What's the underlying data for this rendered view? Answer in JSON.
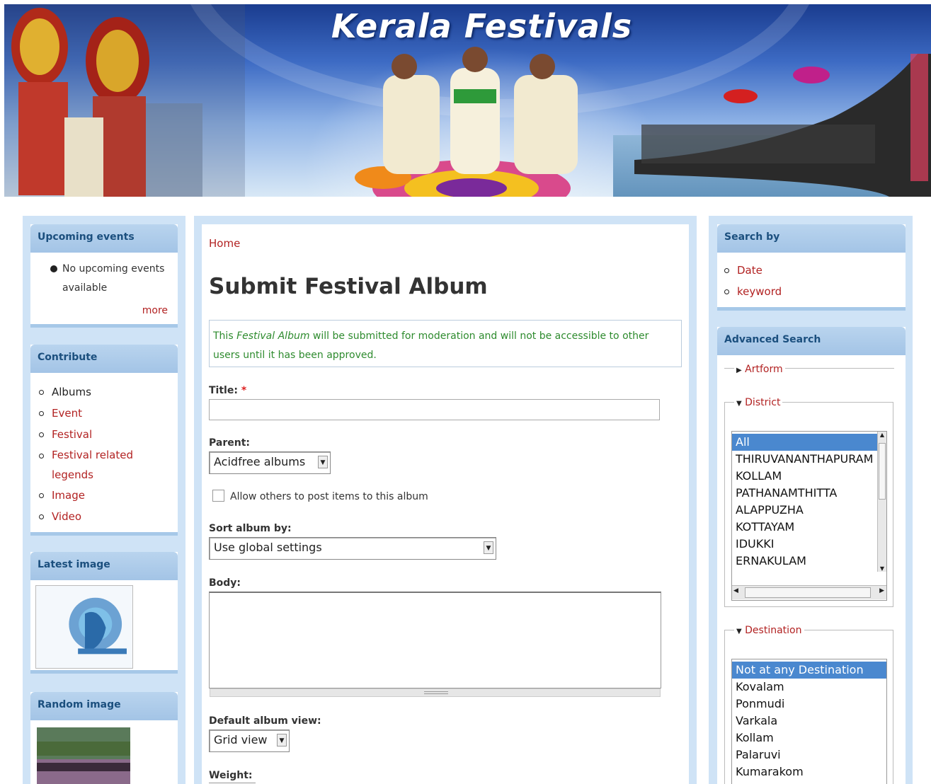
{
  "banner": {
    "title": "Kerala Festivals"
  },
  "left": {
    "upcoming": {
      "title": "Upcoming events",
      "empty_text": "No upcoming events available",
      "more": "more"
    },
    "contribute": {
      "title": "Contribute",
      "items": [
        "Albums",
        "Event",
        "Festival",
        "Festival related legends",
        "Image",
        "Video"
      ]
    },
    "latest_image": {
      "title": "Latest image"
    },
    "random_image": {
      "title": "Random image"
    }
  },
  "main": {
    "breadcrumb": "Home",
    "page_title": "Submit Festival Album",
    "message": {
      "prefix": "This ",
      "em": "Festival Album",
      "suffix": " will be submitted for moderation and will not be accessible to other users until it has been approved."
    },
    "title_label": "Title:",
    "required_mark": "*",
    "title_value": "",
    "parent_label": "Parent:",
    "parent_value": "Acidfree albums",
    "allow_label": "Allow others to post items to this album",
    "sort_label": "Sort album by:",
    "sort_value": "Use global settings",
    "body_label": "Body:",
    "default_view_label": "Default album view:",
    "default_view_value": "Grid view",
    "weight_label": "Weight:"
  },
  "right": {
    "search_by": {
      "title": "Search by",
      "items": [
        "Date",
        "keyword"
      ]
    },
    "advanced": {
      "title": "Advanced Search",
      "artform_legend": "Artform",
      "district_legend": "District",
      "districts": [
        "All",
        "THIRUVANANTHAPURAM",
        "KOLLAM",
        "PATHANAMTHITTA",
        "ALAPPUZHA",
        "KOTTAYAM",
        "IDUKKI",
        "ERNAKULAM"
      ],
      "district_selected": "All",
      "destination_legend": "Destination",
      "destinations": [
        "Not at any Destination",
        "Kovalam",
        "Ponmudi",
        "Varkala",
        "Kollam",
        "Palaruvi",
        "Kumarakom"
      ],
      "destination_selected": "Not at any Destination"
    }
  },
  "colors": {
    "link": "#b22222",
    "block_head": "#1b4f7e",
    "status_green": "#2e8b2e",
    "column_bg": "#cfe3f6"
  }
}
